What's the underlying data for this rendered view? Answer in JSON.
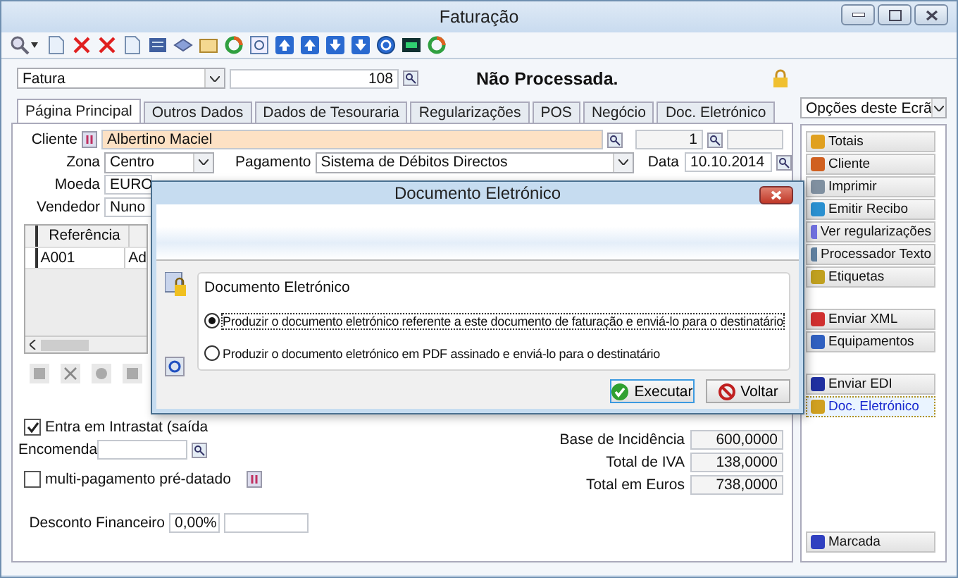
{
  "window": {
    "title": "Faturação"
  },
  "header": {
    "document_type": "Fatura",
    "number": "108",
    "status": "Não Processada."
  },
  "tabs": [
    {
      "label": "Página Principal",
      "selected": true
    },
    {
      "label": "Outros Dados",
      "selected": false
    },
    {
      "label": "Dados de Tesouraria",
      "selected": false
    },
    {
      "label": "Regularizações",
      "selected": false
    },
    {
      "label": "POS",
      "selected": false
    },
    {
      "label": "Negócio",
      "selected": false
    },
    {
      "label": "Doc. Eletrónico",
      "selected": false
    }
  ],
  "options_dropdown": {
    "value": "Opções deste Ecrã"
  },
  "form": {
    "cliente": {
      "label": "Cliente",
      "value": "Albertino Maciel",
      "number": "1"
    },
    "zona": {
      "label": "Zona",
      "value": "Centro"
    },
    "pagamento": {
      "label": "Pagamento",
      "value": "Sistema de Débitos Directos"
    },
    "data": {
      "label": "Data",
      "value": "10.10.2014"
    },
    "moeda": {
      "label": "Moeda",
      "value": "EURO"
    },
    "vendedor": {
      "label": "Vendedor",
      "value": "Nuno"
    }
  },
  "grid": {
    "columns": [
      "Referência"
    ],
    "rows": [
      [
        "A001",
        "Ad"
      ]
    ]
  },
  "intrastat": {
    "label": "Entra em Intrastat (saída",
    "checked": true
  },
  "encomenda": {
    "label": "Encomenda"
  },
  "multipagamento": {
    "label": "multi-pagamento pré-datado",
    "checked": false
  },
  "desconto": {
    "label": "Desconto Financeiro",
    "value": "0,00%"
  },
  "totals": [
    {
      "label": "Base de Incidência",
      "value": "600,0000"
    },
    {
      "label": "Total de IVA",
      "value": "138,0000"
    },
    {
      "label": "Total em Euros",
      "value": "738,0000"
    }
  ],
  "side_groups": [
    {
      "buttons": [
        {
          "label": "Totais",
          "selected": false
        },
        {
          "label": "Cliente",
          "selected": false
        },
        {
          "label": "Imprimir",
          "selected": false
        },
        {
          "label": "Emitir Recibo",
          "selected": false
        },
        {
          "label": "Ver regularizações",
          "selected": false
        },
        {
          "label": "Processador Texto",
          "selected": false
        },
        {
          "label": "Etiquetas",
          "selected": false
        }
      ]
    },
    {
      "buttons": [
        {
          "label": "Enviar XML",
          "selected": false
        },
        {
          "label": "Equipamentos",
          "selected": false
        }
      ]
    },
    {
      "buttons": [
        {
          "label": "Enviar EDI",
          "selected": false
        },
        {
          "label": "Doc. Eletrónico",
          "selected": true
        }
      ]
    },
    {
      "buttons": [
        {
          "label": "Marcada",
          "selected": false
        }
      ]
    }
  ],
  "dialog": {
    "title": "Documento Eletrónico",
    "group_title": "Documento Eletrónico",
    "options": [
      {
        "label": "Produzir o documento eletrónico referente a este documento de faturação e enviá-lo para o destinatário",
        "selected": true
      },
      {
        "label": "Produzir o documento eletrónico em PDF assinado e enviá-lo para o destinatário",
        "selected": false
      }
    ],
    "buttons": [
      {
        "label": "Executar",
        "kind": "ok"
      },
      {
        "label": "Voltar",
        "kind": "cancel"
      }
    ]
  }
}
